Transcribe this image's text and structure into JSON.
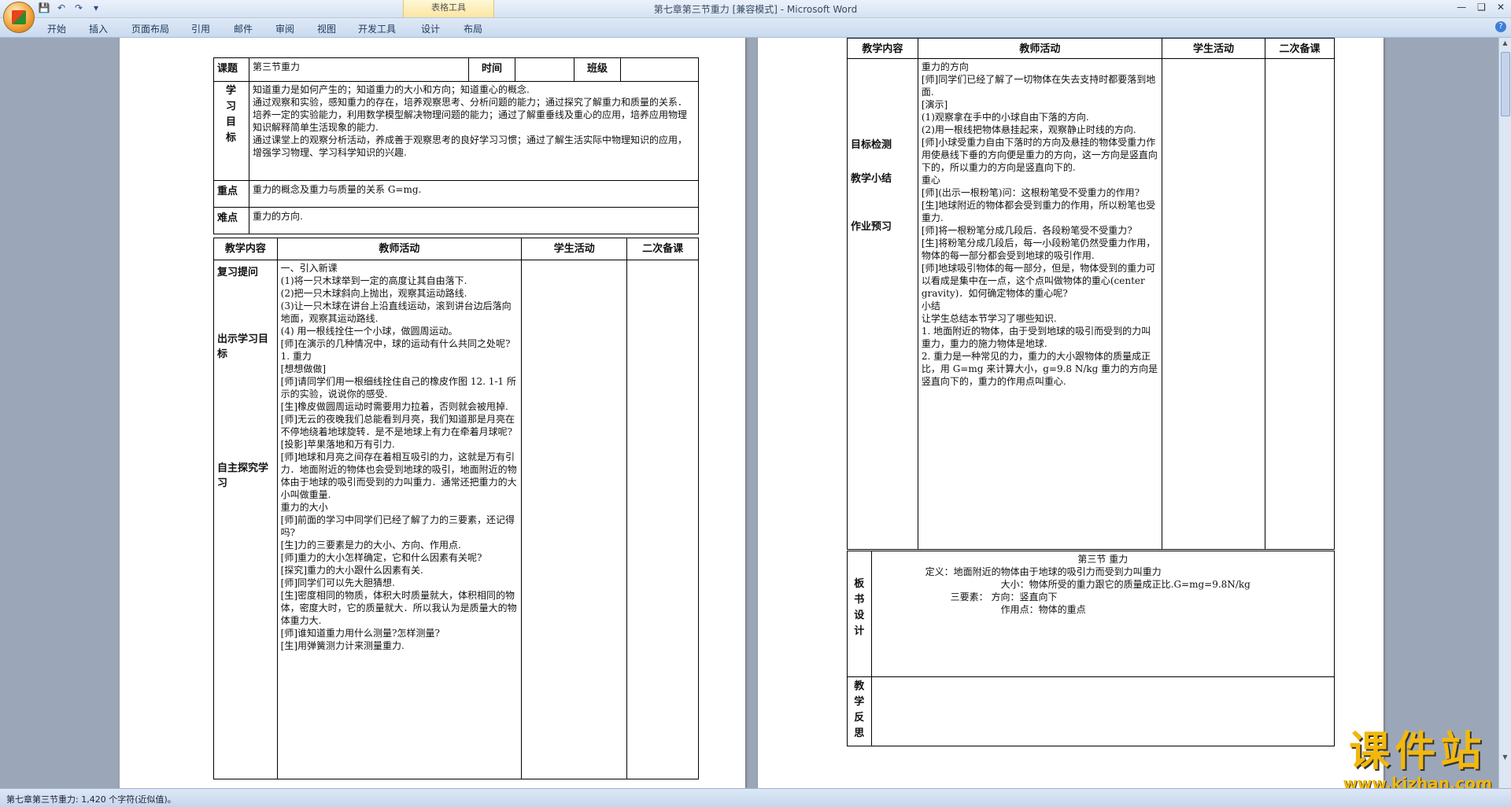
{
  "window": {
    "title": "第七章第三节重力 [兼容模式] - Microsoft Word",
    "context_tab_group": "表格工具"
  },
  "ribbon_tabs": [
    "开始",
    "插入",
    "页面布局",
    "引用",
    "邮件",
    "审阅",
    "视图",
    "开发工具",
    "设计",
    "布局"
  ],
  "left_page": {
    "topic_label": "课题",
    "topic_value": "第三节重力",
    "time_label": "时间",
    "class_label": "班级",
    "goals_label": "学习目标",
    "goals_lines": [
      "知道重力是如何产生的；知道重力的大小和方向；知道重心的概念.",
      "通过观察和实验，感知重力的存在，培养观察思考、分析问题的能力；通过探究了解重力和质量的关系．培养一定的实验能力，利用数学模型解决物理问题的能力；通过了解重垂线及重心的应用，培养应用物理知识解释简单生活现象的能力.",
      "通过课堂上的观察分析活动，养成善于观察思考的良好学习习惯；通过了解生活实际中物理知识的应用，增强学习物理、学习科学知识的兴趣."
    ],
    "key_label": "重点",
    "key_value": "重力的概念及重力与质量的关系 G=mg.",
    "difficult_label": "难点",
    "difficult_value": "重力的方向.",
    "col_headers": [
      "教学内容",
      "教师活动",
      "学生活动",
      "二次备课"
    ],
    "content_labels": [
      "复习提问",
      "出示学习目标",
      "自主探究学习"
    ],
    "teacher_lines": [
      "一、引入新课",
      "  (1)将一只木球举到一定的高度让其自由落下.",
      "  (2)把一只木球斜向上抛出，观察其运动路线.",
      "  (3)让一只木球在讲台上沿直线运动，滚到讲台边后落向地面，观察其运动路线.",
      "  (4) 用一根线拴住一个小球，做圆周运动。",
      "[师]在演示的几种情况中，球的运动有什么共同之处呢?",
      "1. 重力",
      "      [想想做做]",
      "      [师]请同学们用一根细线拴住自己的橡皮作图 12. 1-1 所示的实验，说说你的感受.",
      "      [生]橡皮做圆周运动时需要用力拉着，否则就会被甩掉.",
      "      [师]无云的夜晚我们总能看到月亮，我们知道那是月亮在不停地绕着地球旋转．是不是地球上有力在牵着月球呢?",
      "      [投影]苹果落地和万有引力.",
      "      [师]地球和月亮之间存在着相互吸引的力，这就是万有引力．地面附近的物体也会受到地球的吸引，地面附近的物体由于地球的吸引而受到的力叫重力．通常还把重力的大小叫做重量.",
      "重力的大小",
      "      [师]前面的学习中同学们已经了解了力的三要素，还记得吗?",
      "      [生]力的三要素是力的大小、方向、作用点.",
      "      [师]重力的大小怎样确定，它和什么因素有关呢?",
      "      [探究]重力的大小跟什么因素有关.",
      "      [师]同学们可以先大胆猜想.",
      "      [生]密度相同的物质，体积大时质量就大，体积相同的物体，密度大时，它的质量就大．所以我认为是质量大的物体重力大.",
      "      [师]谁知道重力用什么测量?怎样测量?",
      "      [生]用弹簧测力计来测量重力."
    ]
  },
  "right_page": {
    "col_headers": [
      "教学内容",
      "教师活动",
      "学生活动",
      "二次备课"
    ],
    "content_labels": [
      "目标检测",
      "教学小结",
      "作业预习"
    ],
    "teacher_lines": [
      "重力的方向",
      "      [师]同学们已经了解了一切物体在失去支持时都要落到地面.",
      "      [演示]",
      "      (1)观察拿在手中的小球自由下落的方向.",
      "      (2)用一根线把物体悬挂起来，观察静止时线的方向.",
      "      [师]小球受重力自由下落时的方向及悬挂的物体受重力作用使悬线下垂的方向便是重力的方向，这一方向是竖直向下的，所以重力的方向是竖直向下的.",
      "重心",
      "      [师](出示一根粉笔)问：这根粉笔受不受重力的作用?",
      "      [生]地球附近的物体都会受到重力的作用，所以粉笔也受重力.",
      "      [师]将一根粉笔分成几段后．各段粉笔受不受重力?",
      "      [生]将粉笔分成几段后，每一小段粉笔仍然受重力作用，物体的每一部分都会受到地球的吸引作用.",
      "      [师]地球吸引物体的每一部分，但是，物体受到的重力可以看成是集中在一点，这个点叫做物体的重心(center gravity)．如何确定物体的重心呢?",
      "小结",
      "      让学生总结本节学习了哪些知识.",
      "      1. 地面附近的物体，由于受到地球的吸引而受到的力叫重力，重力的施力物体是地球.",
      "      2. 重力是一种常见的力，重力的大小跟物体的质量成正比，用 G=mg 来计算大小，g=9.8 N/kg 重力的方向是竖直向下的，重力的作用点叫重心."
    ],
    "board_label": "板书设计",
    "board_title": "第三节  重力",
    "board_lines": [
      "定义：地面附近的物体由于地球的吸引力而受到力叫重力",
      "大小：物体所受的重力跟它的质量成正比.G=mg=9.8N/kg",
      "三要素：  方向：竖直向下",
      "作用点：物体的重点"
    ],
    "reflection_label": "教学反思"
  },
  "status_bar": "第七章第三节重力: 1,420 个字符(近似值)。",
  "watermark": {
    "brand": "课件站",
    "url": "www.kjzhan.com"
  },
  "colors": {
    "ribbon_bg": "#d6e3f3",
    "doc_bg": "#9ba7b8",
    "watermark": "#f2b80c",
    "context_tab": "#fbe6a2"
  }
}
